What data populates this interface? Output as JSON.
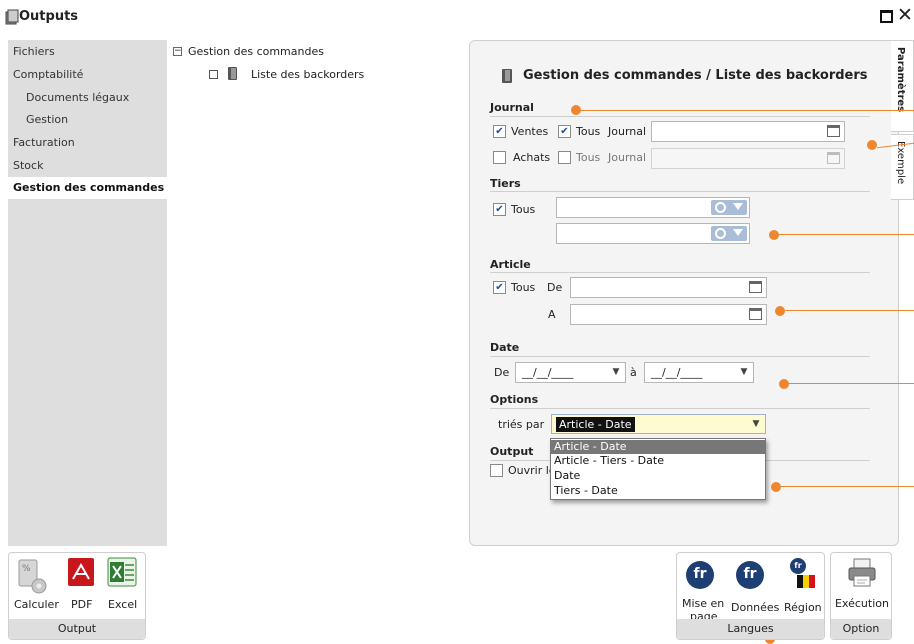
{
  "window": {
    "title": "Outputs"
  },
  "nav": {
    "items": [
      {
        "label": "Fichiers"
      },
      {
        "label": "Comptabilité"
      },
      {
        "label": "Documents légaux"
      },
      {
        "label": "Gestion"
      },
      {
        "label": "Facturation"
      },
      {
        "label": "Stock"
      },
      {
        "label": "Gestion des commandes",
        "selected": true
      }
    ]
  },
  "tree": {
    "root": "Gestion des commandes",
    "child": "Liste des backorders",
    "collapse_glyph": "⊟"
  },
  "main": {
    "title": "Gestion des commandes / Liste des backorders",
    "journal": {
      "title": "Journal",
      "ventes_label": "Ventes",
      "ventes_checked": true,
      "tous_label": "Tous",
      "tous_checked": true,
      "journal_label": "Journal",
      "achats_label": "Achats",
      "achats_checked": false,
      "achats_tous_checked": false
    },
    "tiers": {
      "title": "Tiers",
      "tous_label": "Tous",
      "tous_checked": true
    },
    "article": {
      "title": "Article",
      "tous_label": "Tous",
      "tous_checked": true,
      "de_label": "De",
      "a_label": "A"
    },
    "date": {
      "title": "Date",
      "de_label": "De",
      "a_label": "à",
      "from_value": "__/__/____",
      "to_value": "__/__/____"
    },
    "options": {
      "title": "Options",
      "sort_label": "triés par",
      "sort_value": "Article - Date",
      "sort_options": [
        "Article - Date",
        "Article - Tiers - Date",
        "Date",
        "Tiers - Date"
      ]
    },
    "output": {
      "title": "Output",
      "ouvrir_label": "Ouvrir le"
    }
  },
  "tabs": {
    "parametres": "Paramètres",
    "exemple": "Exemple"
  },
  "ribbon": {
    "output": {
      "footer": "Output",
      "calculer": "Calculer",
      "pdf": "PDF",
      "excel": "Excel"
    },
    "langues": {
      "footer": "Langues",
      "mise_en_page_1": "Mise en",
      "mise_en_page_2": "page",
      "donnees": "Données",
      "region": "Région",
      "flag_text": "fr"
    },
    "option": {
      "footer": "Option",
      "execution": "Exécution"
    }
  },
  "colors": {
    "accent": "#ee8630",
    "check": "#1a4f8f",
    "panel": "#f4f4f4",
    "nav": "#dedede",
    "flag": "#1d3f73"
  },
  "icons": [
    "outputs-icon",
    "maximize-icon",
    "close-icon",
    "collapse-icon",
    "door-icon",
    "folder-icon",
    "search-icon",
    "calendar-icon",
    "calculator-icon",
    "pdf-icon",
    "excel-icon",
    "printer-icon",
    "flag-fr-icon",
    "flag-belgium-icon"
  ]
}
